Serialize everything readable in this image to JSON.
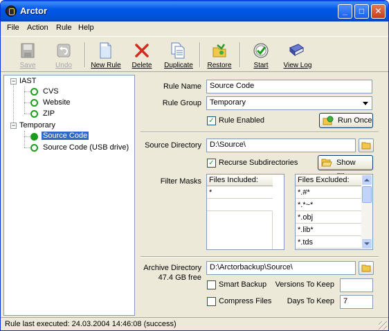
{
  "window": {
    "title": "Arctor"
  },
  "menu": {
    "file": "File",
    "action": "Action",
    "rule": "Rule",
    "help": "Help"
  },
  "toolbar": {
    "save": "Save",
    "undo": "Undo",
    "new_rule": "New Rule",
    "delete": "Delete",
    "duplicate": "Duplicate",
    "restore": "Restore",
    "start": "Start",
    "view_log": "View Log"
  },
  "tree": {
    "group1": "IAST",
    "group1_items": [
      "CVS",
      "Website",
      "ZIP"
    ],
    "group2": "Temporary",
    "group2_items": [
      "Source Code",
      "Source Code (USB drive)"
    ],
    "selected": "Source Code"
  },
  "form": {
    "rule_name_label": "Rule Name",
    "rule_name_value": "Source Code",
    "rule_group_label": "Rule Group",
    "rule_group_value": "Temporary",
    "rule_enabled_label": "Rule Enabled",
    "rule_enabled_checked": true,
    "run_once_label": "Run Once",
    "source_dir_label": "Source Directory",
    "source_dir_value": "D:\\Source\\",
    "recurse_label": "Recurse Subdirectories",
    "recurse_checked": true,
    "show_files_label": "Show Files",
    "filter_masks_label": "Filter Masks",
    "files_included_header": "Files Included:",
    "files_included": [
      "*"
    ],
    "files_excluded_header": "Files Excluded:",
    "files_excluded": [
      "*.#*",
      "*.*~*",
      "*.obj",
      "*.lib*",
      "*.tds"
    ],
    "archive_dir_label": "Archive Directory",
    "free_space": "47.4 GB free",
    "archive_dir_value": "D:\\Arctorbackup\\Source\\",
    "smart_backup_label": "Smart Backup",
    "smart_backup_checked": false,
    "versions_to_keep_label": "Versions To Keep",
    "versions_to_keep_value": "",
    "compress_files_label": "Compress Files",
    "compress_files_checked": false,
    "days_to_keep_label": "Days To Keep",
    "days_to_keep_value": "7"
  },
  "status": {
    "text": "Rule last executed: 24.03.2004 14:46:08 (success)"
  },
  "colors": {
    "title_bar": "#0058e6",
    "selection": "#316ac5",
    "ring": "#1d9b1d"
  }
}
